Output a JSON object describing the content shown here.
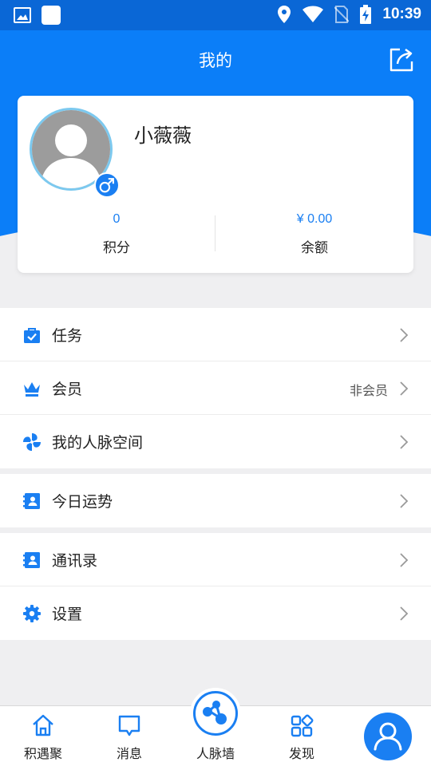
{
  "status_bar": {
    "time": "10:39"
  },
  "header": {
    "title": "我的"
  },
  "profile": {
    "name": "小薇薇",
    "points_value": "0",
    "points_label": "积分",
    "balance_value": "¥ 0.00",
    "balance_label": "余额"
  },
  "menu_groups": [
    [
      {
        "label": "任务",
        "icon": "task-bag-icon"
      },
      {
        "label": "会员",
        "icon": "crown-icon",
        "extra": "非会员"
      },
      {
        "label": "我的人脉空间",
        "icon": "pinwheel-icon"
      }
    ],
    [
      {
        "label": "今日运势",
        "icon": "contact-card-icon"
      }
    ],
    [
      {
        "label": "通讯录",
        "icon": "contact-card-icon"
      },
      {
        "label": "设置",
        "icon": "gear-icon"
      }
    ]
  ],
  "tabs": {
    "home": "积遇聚",
    "messages": "消息",
    "network": "人脉墙",
    "discover": "发现"
  },
  "colors": {
    "primary": "#0b7ef8",
    "statusbar": "#0a67d6",
    "accent": "#1a7ff2",
    "background": "#efeff1"
  }
}
